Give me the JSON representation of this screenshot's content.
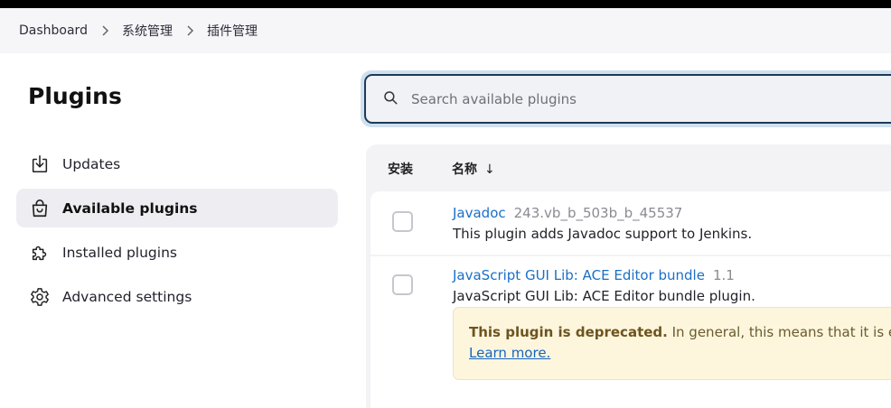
{
  "breadcrumb": {
    "items": [
      "Dashboard",
      "系统管理",
      "插件管理"
    ]
  },
  "page": {
    "title": "Plugins"
  },
  "sidebar": {
    "items": [
      {
        "label": "Updates",
        "icon": "download-icon"
      },
      {
        "label": "Available plugins",
        "icon": "shopping-bag-icon",
        "active": true
      },
      {
        "label": "Installed plugins",
        "icon": "puzzle-icon"
      },
      {
        "label": "Advanced settings",
        "icon": "gear-icon"
      }
    ]
  },
  "search": {
    "placeholder": "Search available plugins",
    "value": ""
  },
  "table": {
    "headers": {
      "install": "安装",
      "name": "名称",
      "sort_indicator": "↓"
    },
    "rows": [
      {
        "name": "Javadoc",
        "version": "243.vb_b_503b_b_45537",
        "description": "This plugin adds Javadoc support to Jenkins.",
        "checked": false
      },
      {
        "name": "JavaScript GUI Lib: ACE Editor bundle",
        "version": "1.1",
        "description": "JavaScript GUI Lib: ACE Editor bundle plugin.",
        "checked": false,
        "warning": {
          "bold": "This plugin is deprecated.",
          "text": " In general, this means that it is eithe",
          "link": "Learn more."
        }
      }
    ]
  },
  "colors": {
    "link": "#1a6fc8",
    "warning_bg": "#fdf6dd",
    "search_focus_ring": "#cfe0ee",
    "search_border": "#1c3b5a"
  }
}
